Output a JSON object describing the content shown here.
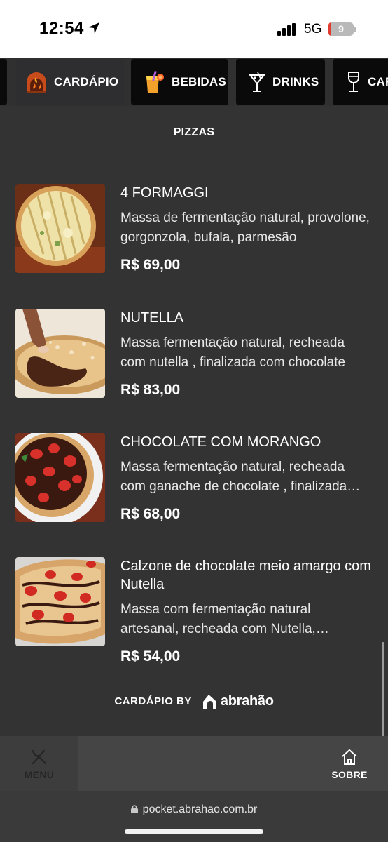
{
  "status_bar": {
    "time": "12:54",
    "network": "5G",
    "battery": "9",
    "battery_level_percent": 9,
    "location_icon": "location-arrow-icon",
    "signal_icon": "signal-bars-icon"
  },
  "tabs": [
    {
      "label": "CARDÁPIO",
      "icon": "pizza-oven-icon",
      "active": true
    },
    {
      "label": "BEBIDAS",
      "icon": "juice-glass-icon",
      "active": false
    },
    {
      "label": "DRINKS",
      "icon": "cocktail-icon",
      "active": false
    },
    {
      "label": "CAR",
      "icon": "wine-glass-icon",
      "active": false
    }
  ],
  "section": {
    "title": "PIZZAS"
  },
  "items": [
    {
      "name": "4 FORMAGGI",
      "description": "Massa de fermentação natural, provolone, gorgonzola, bufala, parmesão",
      "price": "R$ 69,00"
    },
    {
      "name": "NUTELLA",
      "description": "Massa fermentação natural, recheada com nutella , finalizada com chocolate",
      "price": "R$ 83,00"
    },
    {
      "name": "CHOCOLATE COM MORANGO",
      "description": "Massa fermentação natural, recheada com ganache de chocolate , finalizada com morangos",
      "price": "R$ 68,00"
    },
    {
      "name": "Calzone de chocolate meio amargo com Nutella",
      "description": "Massa com fermentação natural artesanal, recheada com Nutella, finalizada",
      "price": "R$ 54,00"
    }
  ],
  "footer": {
    "by_label": "CARDÁPIO BY",
    "brand": "abrahão"
  },
  "bottom_nav": {
    "menu_label": "MENU",
    "about_label": "SOBRE"
  },
  "browser": {
    "url": "pocket.abrahao.com.br"
  },
  "colors": {
    "background": "#333333",
    "tab_dark": "#0a0a0a",
    "nav": "#454545"
  }
}
